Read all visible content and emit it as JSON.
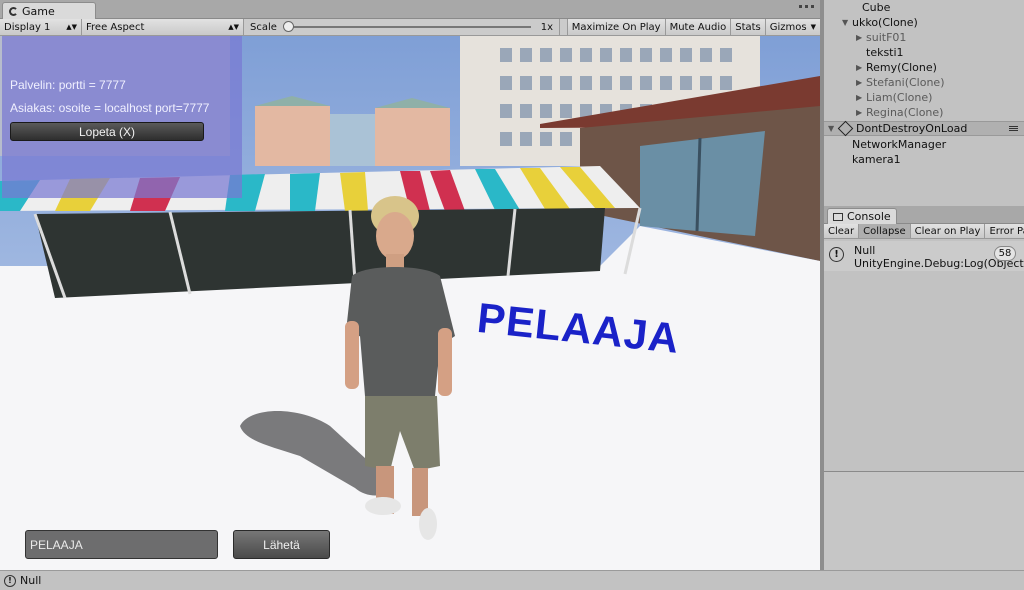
{
  "game_tab": {
    "label": "Game"
  },
  "toolbar": {
    "display": "Display 1",
    "aspect": "Free Aspect",
    "scale_label": "Scale",
    "scale_value": "1x",
    "maximize_on_play": "Maximize On Play",
    "mute_audio": "Mute Audio",
    "stats": "Stats",
    "gizmos": "Gizmos"
  },
  "overlay": {
    "server_line": "Palvelin: portti = 7777",
    "client_line": "Asiakas: osoite = localhost port=7777",
    "stop_button": "Lopeta (X)"
  },
  "world_label": "PELAAJA",
  "chat": {
    "input_value": "PELAAJA",
    "send_button": "Lähetä"
  },
  "hierarchy": {
    "rows": [
      {
        "label": "Cube",
        "indent": 1,
        "arrow": "",
        "dim": false
      },
      {
        "label": "ukko(Clone)",
        "indent": 1,
        "arrow": "▼",
        "dim": false
      },
      {
        "label": "suitF01",
        "indent": 2,
        "arrow": "▶",
        "dim": true
      },
      {
        "label": "teksti1",
        "indent": 3,
        "arrow": "",
        "dim": false
      },
      {
        "label": "Remy(Clone)",
        "indent": 2,
        "arrow": "▶",
        "dim": false
      },
      {
        "label": "Stefani(Clone)",
        "indent": 2,
        "arrow": "▶",
        "dim": true
      },
      {
        "label": "Liam(Clone)",
        "indent": 2,
        "arrow": "▶",
        "dim": true
      },
      {
        "label": "Regina(Clone)",
        "indent": 2,
        "arrow": "▶",
        "dim": true
      }
    ],
    "scene_label": "DontDestroyOnLoad",
    "scene_children": [
      "NetworkManager",
      "kamera1"
    ]
  },
  "console": {
    "tab_label": "Console",
    "buttons": [
      "Clear",
      "Collapse",
      "Clear on Play",
      "Error Pause"
    ],
    "entry": {
      "line1": "Null",
      "line2": "UnityEngine.Debug:Log(Object)",
      "count": "58"
    }
  },
  "status_bar": {
    "message": "Null"
  },
  "colors": {
    "world_label": "#1a22c8",
    "overlay": "#7878d2"
  }
}
